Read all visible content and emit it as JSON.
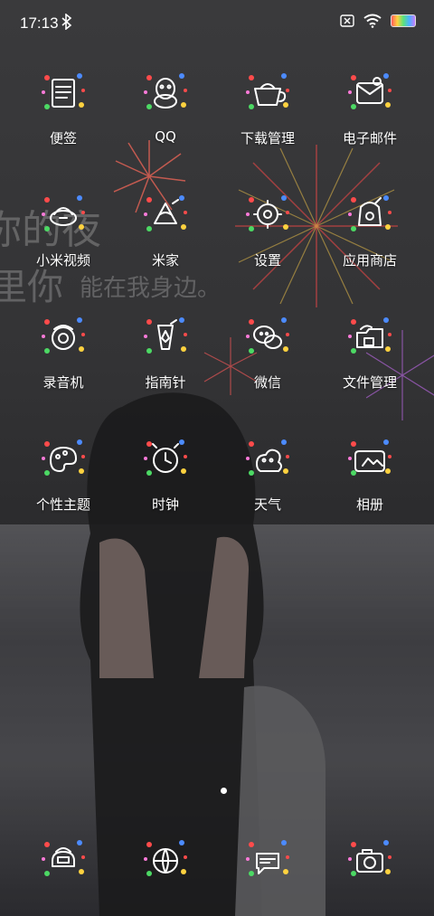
{
  "status_bar": {
    "time": "17:13"
  },
  "wallpaper": {
    "line1": "你的夜",
    "line2": "里你",
    "line3": "能在我身边。"
  },
  "apps": [
    {
      "label": "便签",
      "icon": "notes-icon"
    },
    {
      "label": "QQ",
      "icon": "qq-icon"
    },
    {
      "label": "下载管理",
      "icon": "download-manager-icon"
    },
    {
      "label": "电子邮件",
      "icon": "email-icon"
    },
    {
      "label": "小米视频",
      "icon": "video-icon"
    },
    {
      "label": "米家",
      "icon": "mijia-icon"
    },
    {
      "label": "设置",
      "icon": "settings-icon"
    },
    {
      "label": "应用商店",
      "icon": "app-store-icon"
    },
    {
      "label": "录音机",
      "icon": "recorder-icon"
    },
    {
      "label": "指南针",
      "icon": "compass-icon"
    },
    {
      "label": "微信",
      "icon": "wechat-icon"
    },
    {
      "label": "文件管理",
      "icon": "file-manager-icon"
    },
    {
      "label": "个性主题",
      "icon": "themes-icon"
    },
    {
      "label": "时钟",
      "icon": "clock-icon"
    },
    {
      "label": "天气",
      "icon": "weather-icon"
    },
    {
      "label": "相册",
      "icon": "gallery-icon"
    }
  ],
  "dock": [
    {
      "icon": "phone-icon"
    },
    {
      "icon": "browser-icon"
    },
    {
      "icon": "messages-icon"
    },
    {
      "icon": "camera-icon"
    }
  ],
  "page_indicator": {
    "pages": 2,
    "current": 1
  }
}
